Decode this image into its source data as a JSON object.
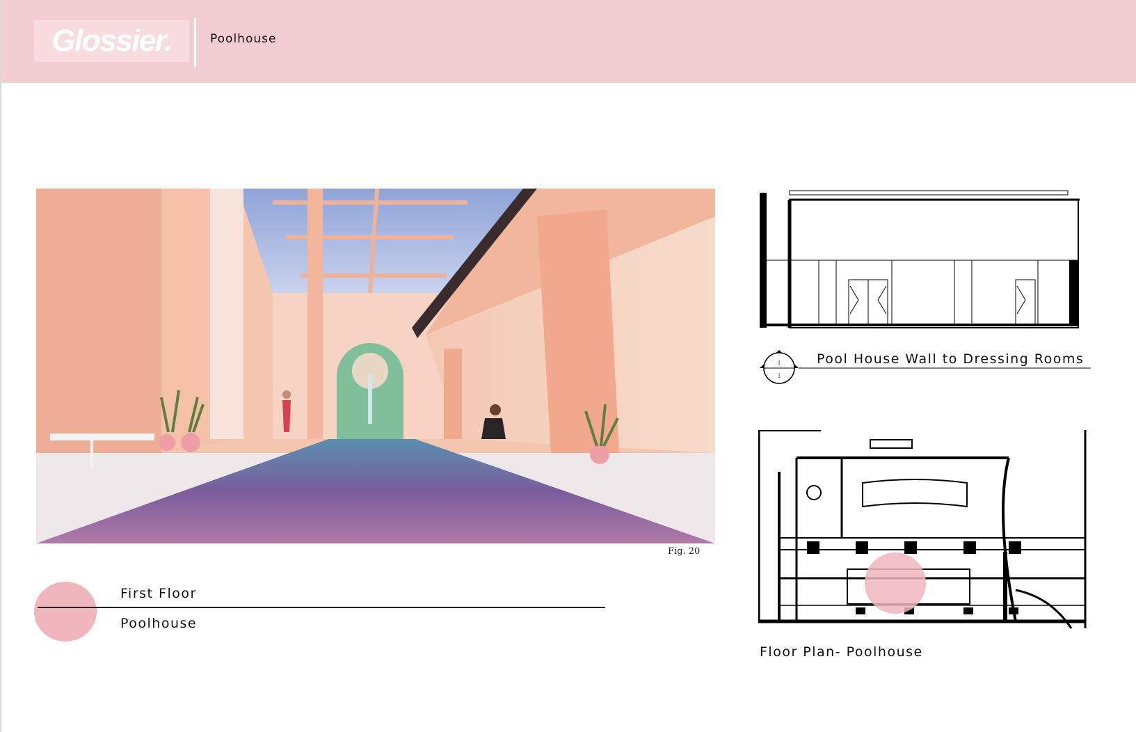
{
  "header": {
    "logo_text": "Glossier.",
    "title": "Poolhouse"
  },
  "render": {
    "caption": "Fig. 20"
  },
  "floor_info": {
    "floor": "First Floor",
    "room": "Poolhouse"
  },
  "elevation": {
    "title": "Pool House Wall to Dressing Rooms",
    "section_marker_top": "1",
    "section_marker_bottom": "1"
  },
  "plan": {
    "title": "Floor Plan- Poolhouse"
  },
  "colors": {
    "header_pink": "#f2ced4",
    "accent_pink": "#efb6bd",
    "wall_peach": "#f0b8a0",
    "pool_violet": "#8a5a9a",
    "tile_green": "#7fbf99"
  }
}
